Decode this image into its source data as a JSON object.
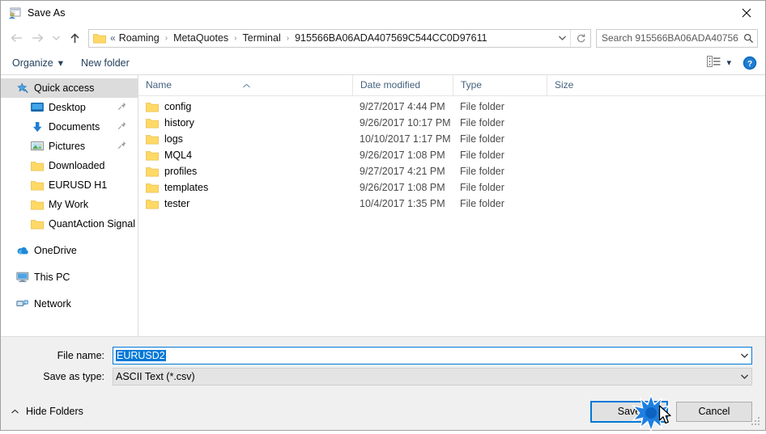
{
  "window": {
    "title": "Save As",
    "icon": "app-icon",
    "close_label": "✕"
  },
  "address": {
    "back_icon": "arrow-left-icon",
    "forward_icon": "arrow-right-icon",
    "recent_icon": "chevron-down-icon",
    "up_icon": "arrow-up-icon",
    "folder_icon": "folder-icon",
    "lead_separator": "«",
    "crumbs": [
      "Roaming",
      "MetaQuotes",
      "Terminal",
      "915566BA06ADA407569C544CC0D97611"
    ],
    "separator": "›",
    "dropdown_icon": "chevron-down-icon",
    "refresh_icon": "refresh-icon"
  },
  "search": {
    "placeholder": "Search 915566BA06ADA40756...",
    "icon": "search-icon"
  },
  "toolbar": {
    "organize_label": "Organize",
    "organize_caret": "▾",
    "new_folder_label": "New folder",
    "view_icon": "view-list-icon",
    "view_caret": "▾",
    "help_icon": "help-icon",
    "help_glyph": "?"
  },
  "sidebar": {
    "items": [
      {
        "label": "Quick access",
        "icon": "star-pin-icon",
        "level": 0,
        "selected": true,
        "pinned": false
      },
      {
        "label": "Desktop",
        "icon": "desktop-icon",
        "level": 1,
        "selected": false,
        "pinned": true
      },
      {
        "label": "Documents",
        "icon": "documents-download-icon",
        "level": 1,
        "selected": false,
        "pinned": true
      },
      {
        "label": "Pictures",
        "icon": "pictures-icon",
        "level": 1,
        "selected": false,
        "pinned": true
      },
      {
        "label": "Downloaded",
        "icon": "folder-icon",
        "level": 1,
        "selected": false,
        "pinned": false
      },
      {
        "label": "EURUSD H1",
        "icon": "folder-icon",
        "level": 1,
        "selected": false,
        "pinned": false
      },
      {
        "label": "My Work",
        "icon": "folder-icon",
        "level": 1,
        "selected": false,
        "pinned": false
      },
      {
        "label": "QuantAction Signal",
        "icon": "folder-icon",
        "level": 1,
        "selected": false,
        "pinned": false
      }
    ],
    "groups": [
      {
        "label": "OneDrive",
        "icon": "onedrive-icon"
      },
      {
        "label": "This PC",
        "icon": "this-pc-icon"
      },
      {
        "label": "Network",
        "icon": "network-icon"
      }
    ]
  },
  "filelist": {
    "columns": [
      {
        "label": "Name",
        "key": "name"
      },
      {
        "label": "Date modified",
        "key": "date"
      },
      {
        "label": "Type",
        "key": "type"
      },
      {
        "label": "Size",
        "key": "size"
      }
    ],
    "sort_indicator": "˄",
    "rows": [
      {
        "name": "config",
        "date": "9/27/2017 4:44 PM",
        "type": "File folder",
        "size": "",
        "icon": "folder-icon"
      },
      {
        "name": "history",
        "date": "9/26/2017 10:17 PM",
        "type": "File folder",
        "size": "",
        "icon": "folder-icon"
      },
      {
        "name": "logs",
        "date": "10/10/2017 1:17 PM",
        "type": "File folder",
        "size": "",
        "icon": "folder-icon"
      },
      {
        "name": "MQL4",
        "date": "9/26/2017 1:08 PM",
        "type": "File folder",
        "size": "",
        "icon": "folder-icon"
      },
      {
        "name": "profiles",
        "date": "9/27/2017 4:21 PM",
        "type": "File folder",
        "size": "",
        "icon": "folder-icon"
      },
      {
        "name": "templates",
        "date": "9/26/2017 1:08 PM",
        "type": "File folder",
        "size": "",
        "icon": "folder-icon"
      },
      {
        "name": "tester",
        "date": "10/4/2017 1:35 PM",
        "type": "File folder",
        "size": "",
        "icon": "folder-icon"
      }
    ]
  },
  "form": {
    "filename_label": "File name:",
    "filename_value": "EURUSD2",
    "filename_selected": true,
    "filetype_label": "Save as type:",
    "filetype_value": "ASCII Text (*.csv)",
    "dropdown_icon": "chevron-down-icon"
  },
  "footer": {
    "hide_folders_label": "Hide Folders",
    "hide_folders_icon": "chevron-up-icon",
    "save_label": "Save",
    "cancel_label": "Cancel",
    "resize_grip": "resize-grip-icon"
  },
  "overlay": {
    "click_burst": "click-burst-icon",
    "cursor": "mouse-pointer-icon"
  },
  "colors": {
    "accent": "#0078d7",
    "folder": "#ffd04b",
    "chrome": "#f0f0f0",
    "header_text": "#44627e"
  }
}
